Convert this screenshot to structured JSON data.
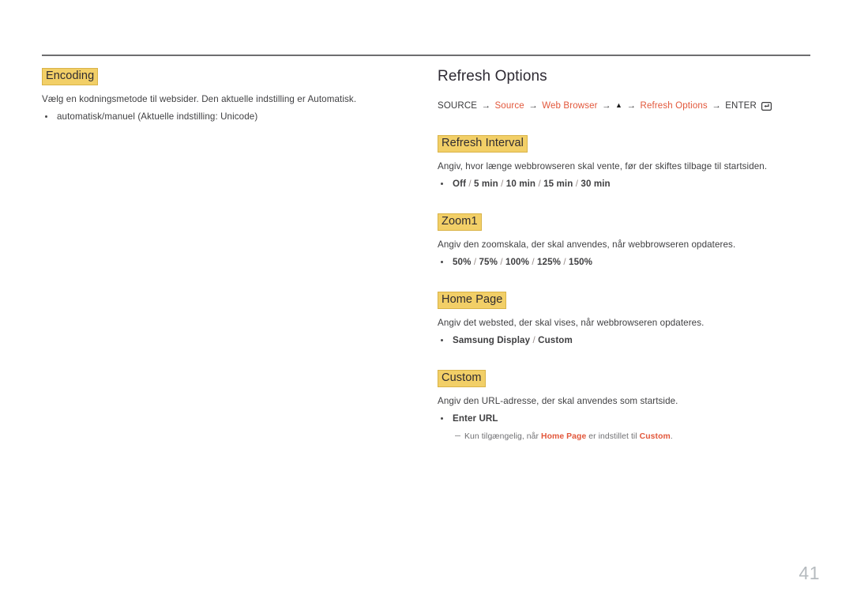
{
  "document": {
    "page_number": "41",
    "accent_color": "#e2573b",
    "highlight_color": "#f2cf67",
    "title_color": "#2e2a33"
  },
  "left_column": {
    "heading": "Encoding",
    "description": "Vælg en kodningsmetode til websider. Den aktuelle indstilling er Automatisk.",
    "bullet": "automatisk/manuel (Aktuelle indstilling: Unicode)"
  },
  "right_column": {
    "title": "Refresh Options",
    "breadcrumb": {
      "start": "SOURCE",
      "arrow": "→",
      "step1": "Source",
      "step2": "Web Browser",
      "triangle": "▲",
      "step3": "Refresh Options",
      "end": "ENTER",
      "enter_icon": "enter-key-icon"
    },
    "sections": [
      {
        "heading": "Refresh Interval",
        "description": "Angiv, hvor længe webbrowseren skal vente, før der skiftes tilbage til startsiden.",
        "options": "Off / 5 min / 10 min / 15 min / 30 min"
      },
      {
        "heading": "Zoom1",
        "description": "Angiv den zoomskala, der skal anvendes, når webbrowseren opdateres.",
        "options": "50% / 75% / 100% / 125% / 150%"
      },
      {
        "heading": "Home Page",
        "description": "Angiv det websted, der skal vises, når webbrowseren opdateres.",
        "options": "Samsung Display / Custom"
      },
      {
        "heading": "Custom",
        "description": "Angiv den URL-adresse, der skal anvendes som startside.",
        "options": "Enter URL",
        "note": {
          "text_before": "Kun tilgængelig, når ",
          "term1": "Home Page",
          "text_middle": " er indstillet til ",
          "term2": "Custom",
          "text_after": "."
        }
      }
    ]
  }
}
